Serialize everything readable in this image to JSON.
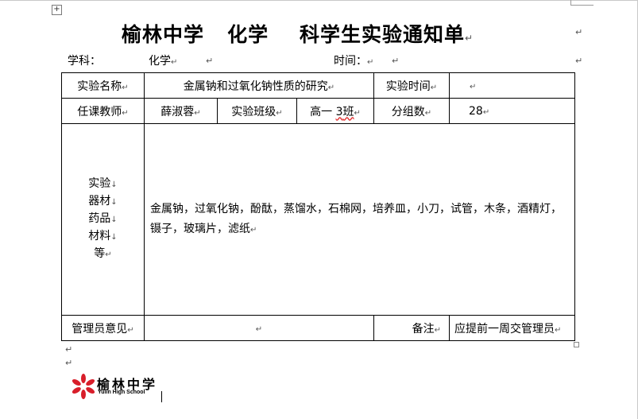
{
  "title": {
    "school": "榆林中学",
    "subject": "化学",
    "doc": "科学生实验通知单"
  },
  "info": {
    "subject_label": "学科：",
    "subject_value": "化学",
    "time_label": "时间："
  },
  "table": {
    "exp_name_label": "实验名称",
    "exp_name_value": "金属钠和过氧化钠性质的研究",
    "exp_time_label": "实验时间",
    "exp_time_value": "",
    "teacher_label": "任课教师",
    "teacher_value": "薛淑蓉",
    "class_label": "实验班级",
    "class_value_prefix": "高一",
    "class_value_num": "3",
    "class_value_suffix": "班",
    "groups_label": "分组数",
    "groups_value": "28",
    "materials_label_lines": [
      "实验",
      "器材",
      "药品",
      "材料",
      "等"
    ],
    "materials_value": "金属钠，过氧化钠，酚酞，蒸馏水，石棉网，培养皿，小刀，试管，木条，酒精灯，镊子，玻璃片，滤纸",
    "admin_label": "管理员意见",
    "admin_value": "",
    "note_label": "备注",
    "note_value": "应提前一周交管理员"
  },
  "marks": {
    "para": "↵",
    "line": "↓",
    "anchor": "+"
  },
  "logo": {
    "cn": "榆林中学",
    "en": "Yulin High School",
    "color": "#d81e2a"
  }
}
